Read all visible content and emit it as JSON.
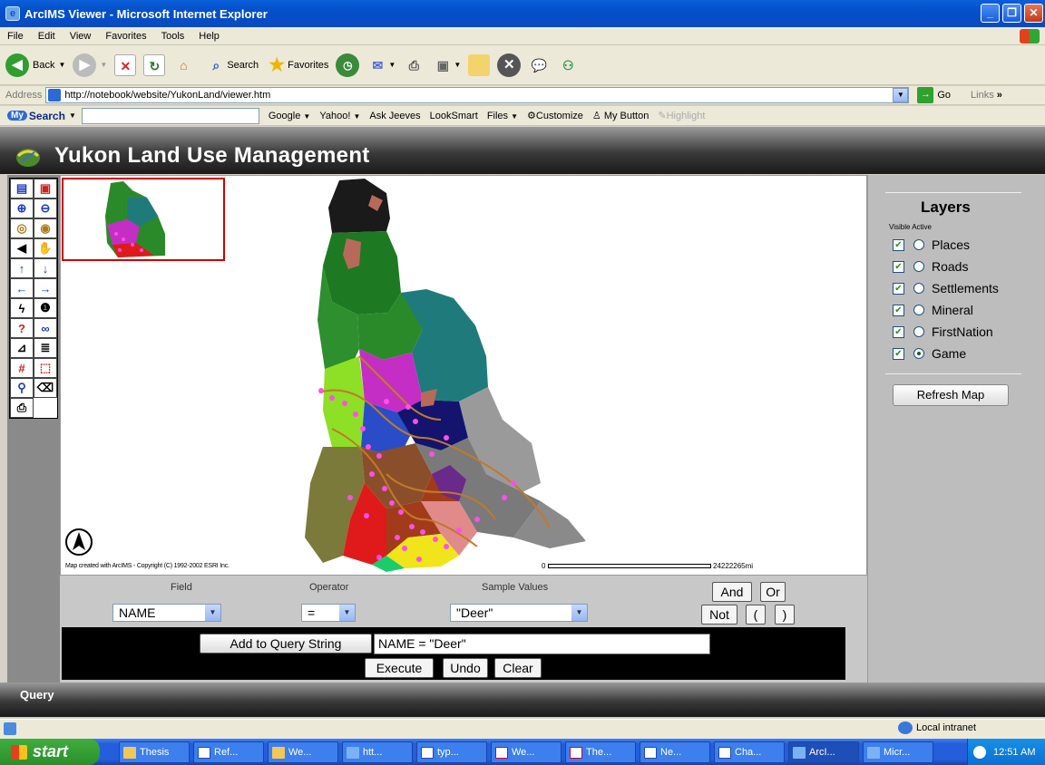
{
  "window": {
    "title": "ArcIMS Viewer - Microsoft Internet Explorer"
  },
  "menu": [
    "File",
    "Edit",
    "View",
    "Favorites",
    "Tools",
    "Help"
  ],
  "toolbar": {
    "back": "Back",
    "search": "Search",
    "favorites": "Favorites"
  },
  "address": {
    "label": "Address",
    "url": "http://notebook/website/YukonLand/viewer.htm",
    "go": "Go",
    "links": "Links"
  },
  "mysearch": {
    "label": "Search",
    "items": [
      "Google",
      "Yahoo!",
      "Ask Jeeves",
      "LookSmart",
      "Files",
      "Customize",
      "My Button",
      "Highlight"
    ]
  },
  "app": {
    "title": "Yukon Land Use Management"
  },
  "map": {
    "copyright": "Map created with ArcIMS - Copyright (C) 1992-2002 ESRI Inc.",
    "scale_start": "0",
    "scale_end": "24222265mi"
  },
  "layers": {
    "title": "Layers",
    "header": "Visible Active",
    "items": [
      {
        "name": "Places",
        "visible": true,
        "active": false
      },
      {
        "name": "Roads",
        "visible": true,
        "active": false
      },
      {
        "name": "Settlements",
        "visible": true,
        "active": false
      },
      {
        "name": "Mineral",
        "visible": true,
        "active": false
      },
      {
        "name": "FirstNation",
        "visible": true,
        "active": false
      },
      {
        "name": "Game",
        "visible": true,
        "active": true
      }
    ],
    "refresh": "Refresh Map"
  },
  "query": {
    "field_label": "Field",
    "operator_label": "Operator",
    "sample_label": "Sample Values",
    "field_value": "NAME",
    "operator_value": "=",
    "sample_value": "\"Deer\"",
    "and": "And",
    "or": "Or",
    "not": "Not",
    "lparen": "(",
    "rparen": ")",
    "add": "Add to Query String",
    "string": "NAME = \"Deer\"",
    "execute": "Execute",
    "undo": "Undo",
    "clear": "Clear",
    "footer": "Query"
  },
  "status": {
    "zone": "Local intranet"
  },
  "taskbar": {
    "start": "start",
    "tasks": [
      "Thesis",
      "Ref...",
      "We...",
      "htt...",
      "typ...",
      "We...",
      "The...",
      "Ne...",
      "Cha...",
      "ArcI...",
      "Micr..."
    ],
    "clock": "12:51 AM"
  }
}
